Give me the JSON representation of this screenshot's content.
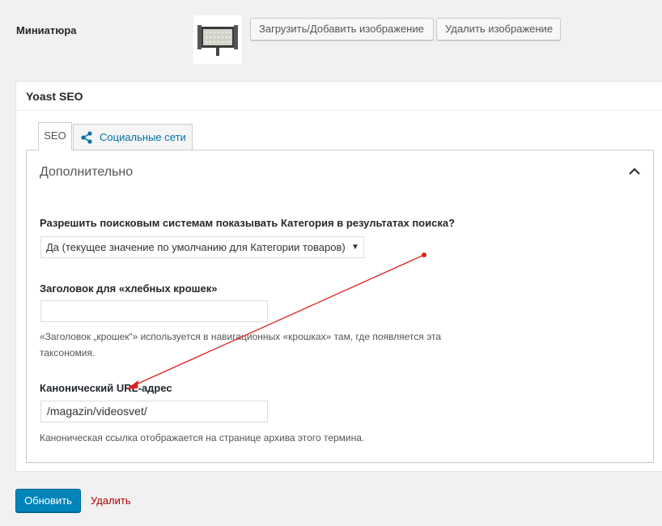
{
  "thumbnail": {
    "label": "Миниатюра",
    "upload_button": "Загрузить/Добавить изображение",
    "remove_button": "Удалить изображение"
  },
  "yoast": {
    "title": "Yoast SEO",
    "tabs": [
      {
        "label": "SEO",
        "active": true
      },
      {
        "label": "Социальные сети",
        "active": false
      }
    ],
    "section_heading": "Дополнительно",
    "index_label": "Разрешить поисковым системам показывать Категория в результатах поиска?",
    "index_select_value": "Да (текущее значение по умолчанию для Категории товаров)",
    "breadcrumbs_label": "Заголовок для «хлебных крошек»",
    "breadcrumbs_value": "",
    "breadcrumbs_help_line1": "«Заголовок „крошек“» используется в навигационных «крошках» там, где появляется эта",
    "breadcrumbs_help_line2": "таксономия.",
    "canonical_label": "Канонический URL-адрес",
    "canonical_value": "/magazin/videosvet/",
    "canonical_help": "Каноническая ссылка отображается на странице архива этого термина."
  },
  "actions": {
    "update_button": "Обновить",
    "delete_link": "Удалить"
  },
  "colors": {
    "primary": "#0085ba",
    "link": "#0073aa",
    "delete": "#a00",
    "annotation_arrow": "#e02020"
  }
}
